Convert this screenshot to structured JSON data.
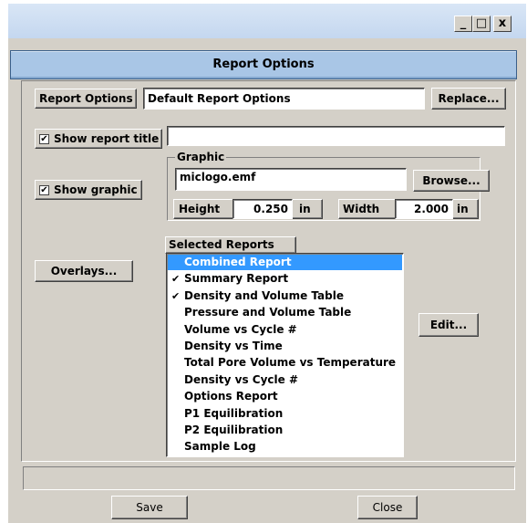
{
  "window": {
    "minimize_glyph": "_",
    "maximize_glyph": "□",
    "close_glyph": "x"
  },
  "header": {
    "title": "Report Options"
  },
  "report_options": {
    "label": "Report Options",
    "value": "Default Report Options",
    "replace_label": "Replace..."
  },
  "show_title": {
    "label": "Show report title",
    "checked": true,
    "value": ""
  },
  "graphic": {
    "group_label": "Graphic",
    "show_label": "Show graphic",
    "checked": true,
    "file_value": "miclogo.emf",
    "browse_label": "Browse...",
    "height_label": "Height",
    "height_value": "0.250",
    "height_unit": "in",
    "width_label": "Width",
    "width_value": "2.000",
    "width_unit": "in"
  },
  "overlays_label": "Overlays...",
  "selected_reports": {
    "label": "Selected Reports",
    "items": [
      {
        "label": "Combined Report",
        "checked": false,
        "selected": true
      },
      {
        "label": "Summary Report",
        "checked": true,
        "selected": false
      },
      {
        "label": "Density and Volume Table",
        "checked": true,
        "selected": false
      },
      {
        "label": "Pressure and Volume Table",
        "checked": false,
        "selected": false
      },
      {
        "label": "Volume vs Cycle #",
        "checked": false,
        "selected": false
      },
      {
        "label": "Density vs Time",
        "checked": false,
        "selected": false
      },
      {
        "label": "Total Pore Volume vs Temperature",
        "checked": false,
        "selected": false
      },
      {
        "label": "Density vs Cycle #",
        "checked": false,
        "selected": false
      },
      {
        "label": "Options Report",
        "checked": false,
        "selected": false
      },
      {
        "label": "P1 Equilibration",
        "checked": false,
        "selected": false
      },
      {
        "label": "P2 Equilibration",
        "checked": false,
        "selected": false
      },
      {
        "label": "Sample Log",
        "checked": false,
        "selected": false
      }
    ]
  },
  "edit_label": "Edit...",
  "status": {
    "text": ""
  },
  "footer": {
    "save_label": "Save",
    "close_label": "Close"
  }
}
